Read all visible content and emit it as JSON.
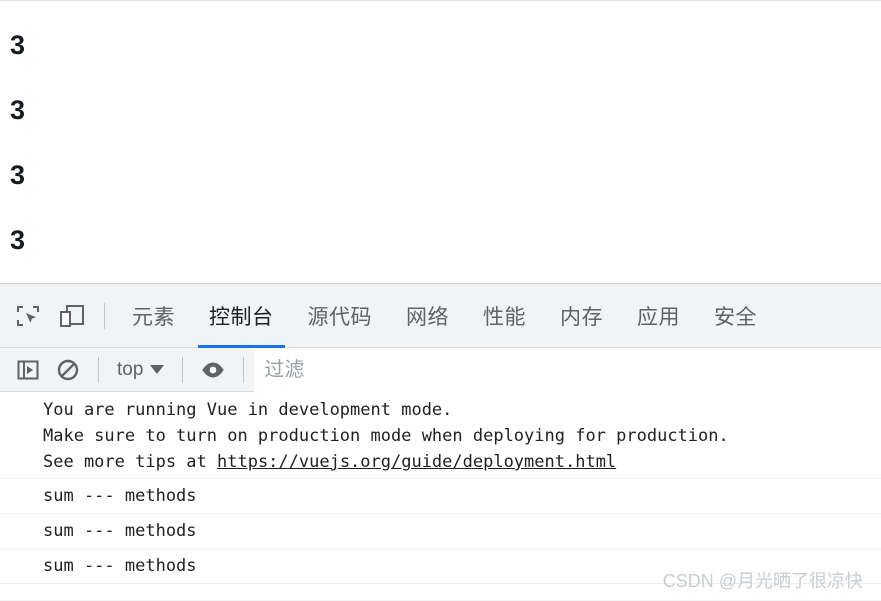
{
  "page": {
    "values": [
      "3",
      "3",
      "3",
      "3"
    ]
  },
  "devtools": {
    "toolbar": {
      "inspect_icon": "inspect-element-icon",
      "device_icon": "device-toolbar-icon"
    },
    "tabs": [
      {
        "label": "元素",
        "active": false
      },
      {
        "label": "控制台",
        "active": true
      },
      {
        "label": "源代码",
        "active": false
      },
      {
        "label": "网络",
        "active": false
      },
      {
        "label": "性能",
        "active": false
      },
      {
        "label": "内存",
        "active": false
      },
      {
        "label": "应用",
        "active": false
      },
      {
        "label": "安全",
        "active": false
      }
    ],
    "console_toolbar": {
      "sidebar_icon": "console-sidebar-icon",
      "clear_icon": "clear-console-icon",
      "context": "top",
      "eye_icon": "live-expression-eye-icon",
      "filter_placeholder": "过滤"
    },
    "messages": [
      {
        "lines": [
          "You are running Vue in development mode.",
          "Make sure to turn on production mode when deploying for production."
        ],
        "tail_prefix": "See more tips at ",
        "link": "https://vuejs.org/guide/deployment.html"
      },
      {
        "text": "sum --- methods"
      },
      {
        "text": "sum --- methods"
      },
      {
        "text": "sum --- methods"
      }
    ]
  },
  "watermark": "CSDN @月光晒了很凉快",
  "colors": {
    "accent": "#1a73e8",
    "toolbar_bg": "#f1f3f4",
    "text": "#202124",
    "muted": "#5f6368",
    "watermark": "#c8cdd1"
  }
}
